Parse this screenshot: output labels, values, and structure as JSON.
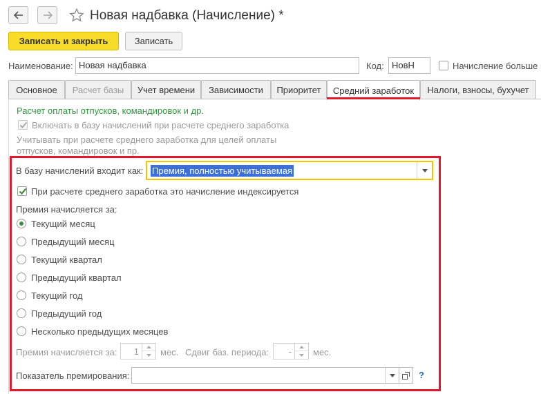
{
  "window": {
    "title": "Новая надбавка (Начисление) *"
  },
  "toolbar": {
    "save_close_label": "Записать и закрыть",
    "save_label": "Записать"
  },
  "header": {
    "name_label": "Наименование:",
    "name_value": "Новая надбавка",
    "code_label": "Код:",
    "code_value": "НовН",
    "accrual_more_label": "Начисление больше н"
  },
  "tabs": [
    {
      "label": "Основное",
      "state": "normal"
    },
    {
      "label": "Расчет базы",
      "state": "disabled"
    },
    {
      "label": "Учет времени",
      "state": "normal"
    },
    {
      "label": "Зависимости",
      "state": "normal"
    },
    {
      "label": "Приоритет",
      "state": "normal"
    },
    {
      "label": "Средний заработок",
      "state": "active"
    },
    {
      "label": "Налоги, взносы, бухучет",
      "state": "normal"
    }
  ],
  "content": {
    "section_title": "Расчет оплаты отпусков, командировок и др.",
    "include_base_label": "Включать в базу начислений при расчете среднего заработка",
    "hint_line1": "Учитывать при расчете среднего заработка для целей оплаты",
    "hint_line2": "отпусков, командировок и пр.",
    "base_label": "В базу начислений входит как:",
    "base_value": "Премия, полностью учитываемая",
    "indexed_label": "При расчете среднего заработка это начисление индексируется",
    "bonus_for_title": "Премия начисляется за:",
    "period_options": [
      {
        "label": "Текущий месяц",
        "selected": true
      },
      {
        "label": "Предыдущий месяц",
        "selected": false
      },
      {
        "label": "Текущий квартал",
        "selected": false
      },
      {
        "label": "Предыдущий квартал",
        "selected": false
      },
      {
        "label": "Текущий год",
        "selected": false
      },
      {
        "label": "Предыдущий год",
        "selected": false
      },
      {
        "label": "Несколько предыдущих месяцев",
        "selected": false
      }
    ],
    "bonus_for_disabled_label": "Премия начисляется за:",
    "months_value": "1",
    "months_unit": "мес.",
    "shift_label": "Сдвиг баз. периода:",
    "shift_value": "-",
    "shift_unit": "мес.",
    "indicator_label": "Показатель премирования:",
    "indicator_value": "",
    "help_label": "?"
  },
  "colors": {
    "accent_yellow": "#f9dc29",
    "highlight_red": "#e3182a",
    "section_green": "#2f9a3e",
    "selection_blue": "#3d6fd8"
  }
}
